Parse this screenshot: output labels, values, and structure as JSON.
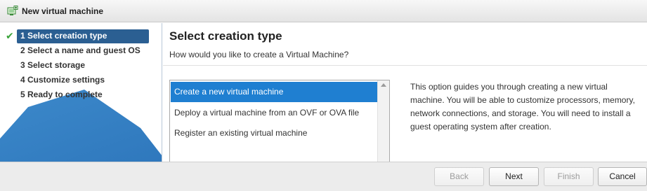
{
  "window": {
    "title": "New virtual machine",
    "icon": "new-vm-icon"
  },
  "sidebar": {
    "steps": [
      {
        "label": "1  Select creation type",
        "state": "active"
      },
      {
        "label": "2  Select a name and guest OS",
        "state": "pending"
      },
      {
        "label": "3  Select storage",
        "state": "pending"
      },
      {
        "label": "4  Customize settings",
        "state": "pending"
      },
      {
        "label": "5  Ready to complete",
        "state": "pending"
      }
    ]
  },
  "main": {
    "title": "Select creation type",
    "subtitle": "How would you like to create a Virtual Machine?",
    "options": [
      {
        "label": "Create a new virtual machine",
        "selected": true
      },
      {
        "label": "Deploy a virtual machine from an OVF or OVA file",
        "selected": false
      },
      {
        "label": "Register an existing virtual machine",
        "selected": false
      }
    ],
    "description": "This option guides you through creating a new virtual machine. You will be able to customize processors, memory, network connections, and storage. You will need to install a guest operating system after creation."
  },
  "footer": {
    "back_label": "Back",
    "next_label": "Next",
    "finish_label": "Finish",
    "cancel_label": "Cancel"
  },
  "colors": {
    "accent": "#1f7fd1",
    "active_step": "#2b5f92",
    "check": "#3aa33a"
  }
}
